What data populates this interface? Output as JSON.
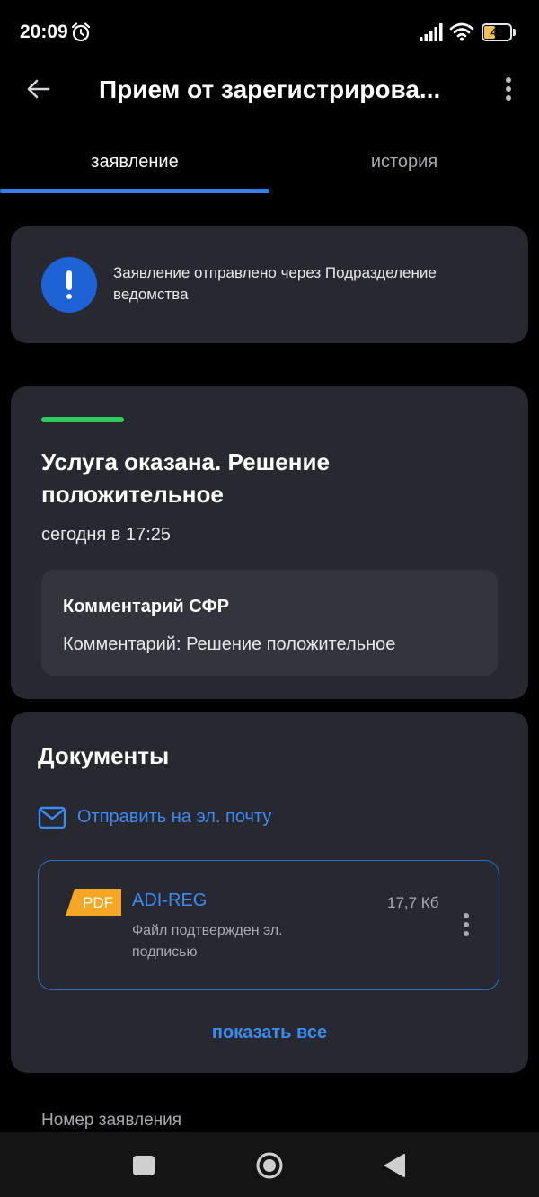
{
  "status_bar": {
    "time": "20:09",
    "battery_percent": "42",
    "battery_level": 0.42
  },
  "app_bar": {
    "title": "Прием от зарегистрирова..."
  },
  "tabs": [
    {
      "label": "заявление",
      "active": true
    },
    {
      "label": "история",
      "active": false
    }
  ],
  "info_card": {
    "text": "Заявление отправлено через Подразделение ведомства"
  },
  "status_card": {
    "title": "Услуга оказана. Решение положительное",
    "date": "сегодня в 17:25",
    "comment_title": "Комментарий СФР",
    "comment_text": "Комментарий: Решение положительное"
  },
  "documents_card": {
    "title": "Документы",
    "email_link": "Отправить на эл. почту",
    "file": {
      "badge": "PDF",
      "name": "ADI-REG",
      "size": "17,7 Кб",
      "description": "Файл подтвержден эл. подписью"
    },
    "show_all": "показать все"
  },
  "application_number_label": "Номер заявления",
  "icons": {
    "alarm": "alarm-icon",
    "signal": "signal-icon",
    "wifi": "wifi-icon",
    "back": "back-arrow-icon",
    "more": "more-vertical-icon",
    "info": "exclamation-icon",
    "mail": "mail-icon",
    "pdf": "pdf-icon"
  },
  "colors": {
    "accent": "#2f80ed",
    "link": "#3a8cf0",
    "success": "#2ecc59",
    "info_icon": "#1e63d6",
    "pdf_badge": "#f5a623",
    "card": "#272830",
    "battery": "#f2c14e"
  }
}
